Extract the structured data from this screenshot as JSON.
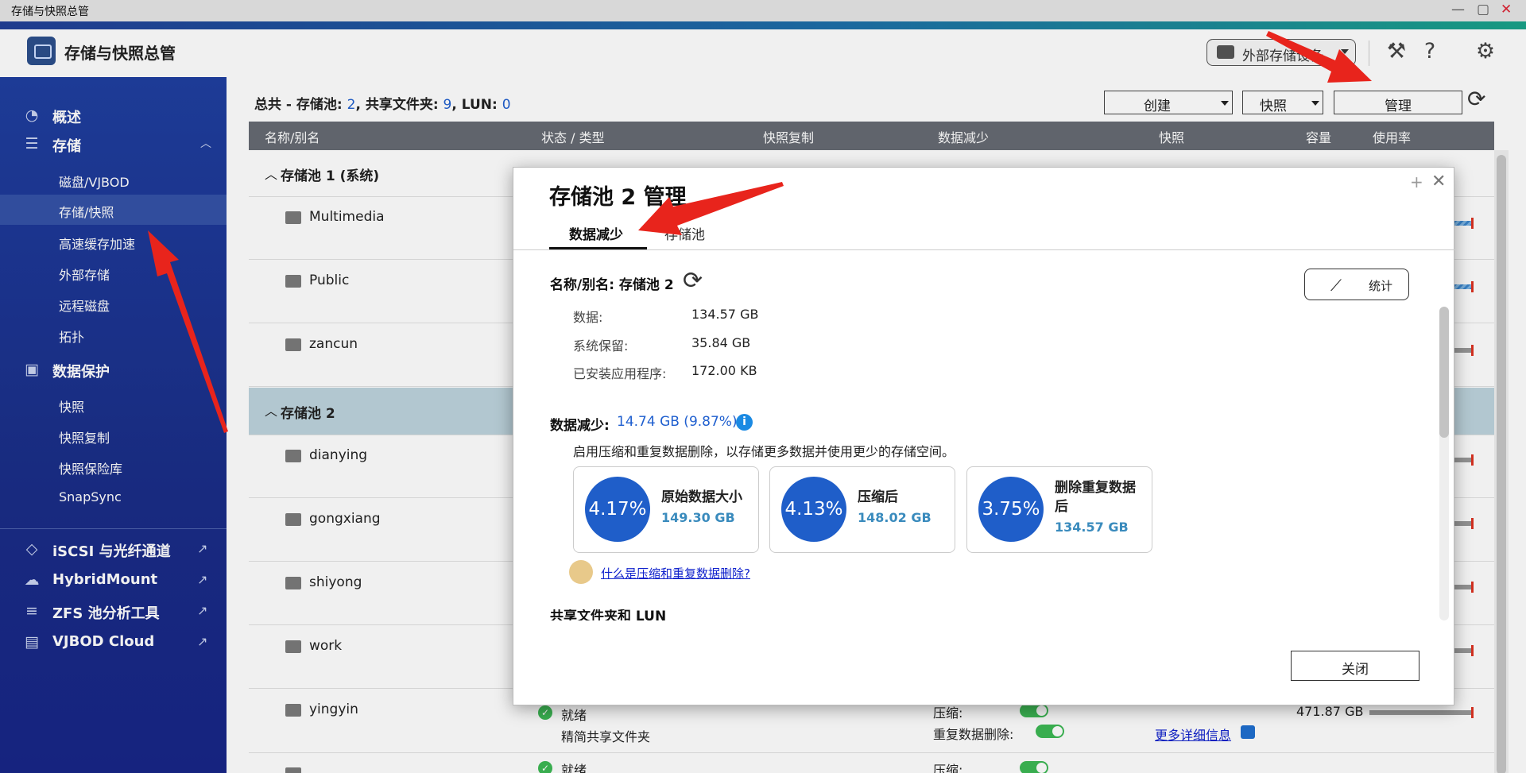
{
  "window": {
    "title": "存储与快照总管",
    "controls": [
      "minimize",
      "maximize",
      "close"
    ]
  },
  "header": {
    "app_title": "存储与快照总管",
    "external_device_label": "外部存储设备",
    "icons": [
      "tools-icon",
      "help-icon",
      "settings-icon"
    ]
  },
  "sidebar": {
    "sections": [
      {
        "label": "概述",
        "icon": "dashboard-icon"
      },
      {
        "label": "存储",
        "icon": "database-icon"
      },
      {
        "label": "数据保护",
        "icon": "safe-icon"
      }
    ],
    "storage_items": [
      "磁盘/VJBOD",
      "存储/快照",
      "高速缓存加速",
      "外部存储",
      "远程磁盘",
      "拓扑"
    ],
    "protection_items": [
      "快照",
      "快照复制",
      "快照保险库",
      "SnapSync"
    ],
    "external_links": [
      {
        "label": "iSCSI 与光纤通道",
        "icon": "iscsi-icon"
      },
      {
        "label": "HybridMount",
        "icon": "cloud-mount-icon"
      },
      {
        "label": "ZFS 池分析工具",
        "icon": "zfs-icon"
      },
      {
        "label": "VJBOD Cloud",
        "icon": "vjbod-cloud-icon"
      }
    ],
    "selected": "存储/快照"
  },
  "summary": {
    "prefix": "总共 - 存储池: ",
    "pools": "2",
    "shares_label": ", 共享文件夹: ",
    "shares": "9",
    "lun_label": ", LUN: ",
    "luns": "0"
  },
  "toolbar": {
    "create": "创建",
    "snapshot": "快照",
    "manage": "管理"
  },
  "table": {
    "columns": [
      "名称/别名",
      "状态 / 类型",
      "快照复制",
      "数据减少",
      "快照",
      "容量",
      "使用率"
    ],
    "pool1": "存储池 1 (系统)",
    "pool1_folders": [
      "Multimedia",
      "Public",
      "zancun"
    ],
    "pool2": "存储池 2",
    "pool2_folders": [
      "dianying",
      "gongxiang",
      "shiyong",
      "work",
      "yingyin"
    ],
    "yingyin_status": "就绪",
    "yingyin_type": "精简共享文件夹",
    "yingyin_compress": "压缩:",
    "yingyin_dedup": "重复数据删除:",
    "yingyin_capacity": "471.87 GB",
    "more_details": "更多详细信息",
    "next_status": "就绪",
    "next_compress": "压缩:"
  },
  "modal": {
    "title": "存储池 2 管理",
    "tabs": [
      "数据减少",
      "存储池"
    ],
    "active_tab": "数据减少",
    "name_label": "名称/别名: 存储池 2",
    "stats_button": "统计",
    "details": [
      {
        "key": "数据:",
        "value": "134.57 GB"
      },
      {
        "key": "系统保留:",
        "value": "35.84 GB"
      },
      {
        "key": "已安装应用程序:",
        "value": "172.00 KB"
      }
    ],
    "reduction_label": "数据减少:",
    "reduction_value": "14.74 GB (9.87%)",
    "description": "启用压缩和重复数据删除，以存储更多数据并使用更少的存储空间。",
    "cards": [
      {
        "percent": "4.17%",
        "title": "原始数据大小",
        "value": "149.30 GB"
      },
      {
        "percent": "4.13%",
        "title": "压缩后",
        "value": "148.02 GB"
      },
      {
        "percent": "3.75%",
        "title": "删除重复数据后",
        "value": "134.57 GB"
      }
    ],
    "help_link": "什么是压缩和重复数据删除?",
    "next_section": "共享文件夹和 LUN",
    "close_button": "关闭"
  },
  "colors": {
    "sidebar": "#1f3fa0",
    "accent": "#1f5ec9",
    "link": "#1022cc",
    "arrow": "#e8241c"
  }
}
